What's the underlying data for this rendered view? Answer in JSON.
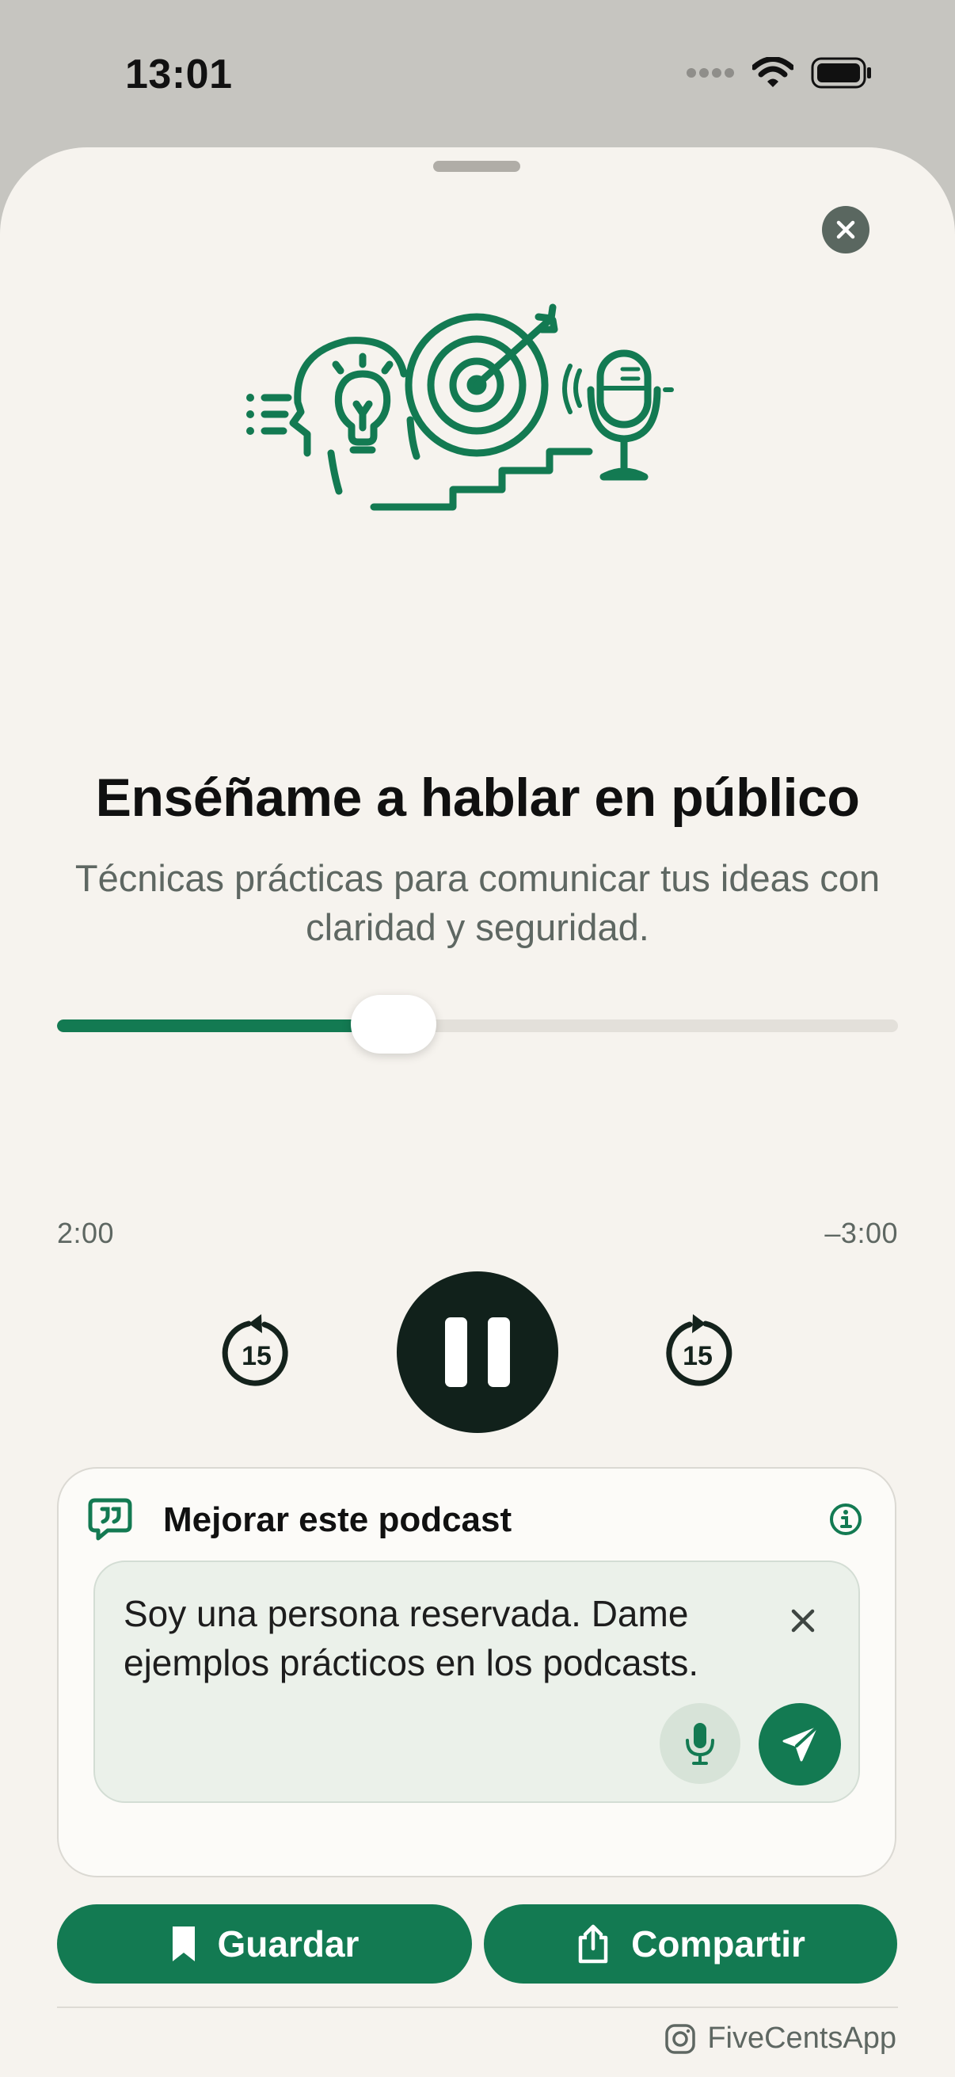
{
  "status_bar": {
    "time": "13:01"
  },
  "episode": {
    "title": "Enséñame a hablar en público",
    "subtitle": "Técnicas prácticas para comunicar tus ideas con claridad y seguridad."
  },
  "player": {
    "elapsed": "2:00",
    "remaining": "–3:00",
    "progress": 0.4,
    "skip_back_seconds": "15",
    "skip_forward_seconds": "15",
    "state": "playing"
  },
  "feedback": {
    "title": "Mejorar este podcast",
    "input_value": "Soy una persona reservada. Dame ejemplos prácticos en los podcasts."
  },
  "actions": {
    "save_label": "Guardar",
    "share_label": "Compartir"
  },
  "footer": {
    "handle": "FiveCentsApp"
  },
  "colors": {
    "accent": "#137a52",
    "play_button": "#11211b",
    "sheet_background": "#f6f3ee"
  }
}
